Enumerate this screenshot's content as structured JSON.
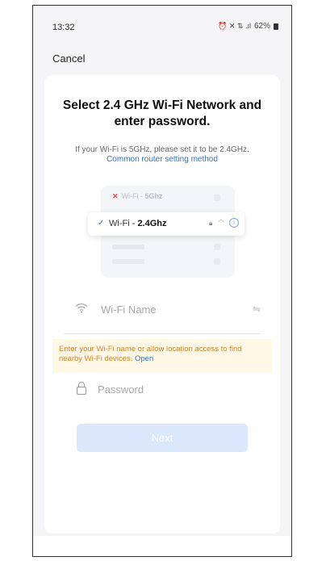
{
  "status": {
    "time": "13:32",
    "icons": "⏰ ✕ ⇅ .ıl",
    "battery": "62%"
  },
  "header": {
    "cancel_label": "Cancel"
  },
  "card": {
    "title": "Select 2.4 GHz Wi-Fi Network and enter password.",
    "note": "If your Wi-Fi is 5GHz, please set it to be 2.4GHz.",
    "note_link": "Common router setting method",
    "illustration": {
      "wifi5_prefix": "Wi-Fi - ",
      "wifi5_band": "5Ghz",
      "wifi24_prefix": "Wi-Fi - ",
      "wifi24_band": "2.4Ghz"
    },
    "wifi_name": {
      "placeholder": "Wi-Fi Name",
      "value": ""
    },
    "banner": {
      "text": "Enter your Wi-Fi name or allow location access to find nearby Wi-Fi devices.",
      "link": "Open"
    },
    "password": {
      "placeholder": "Password",
      "value": ""
    },
    "next_label": "Next"
  },
  "colors": {
    "accent": "#2f72c9",
    "banner_bg": "#fff8e6",
    "banner_text": "#d3852f",
    "next_disabled": "#dbe7fb"
  }
}
